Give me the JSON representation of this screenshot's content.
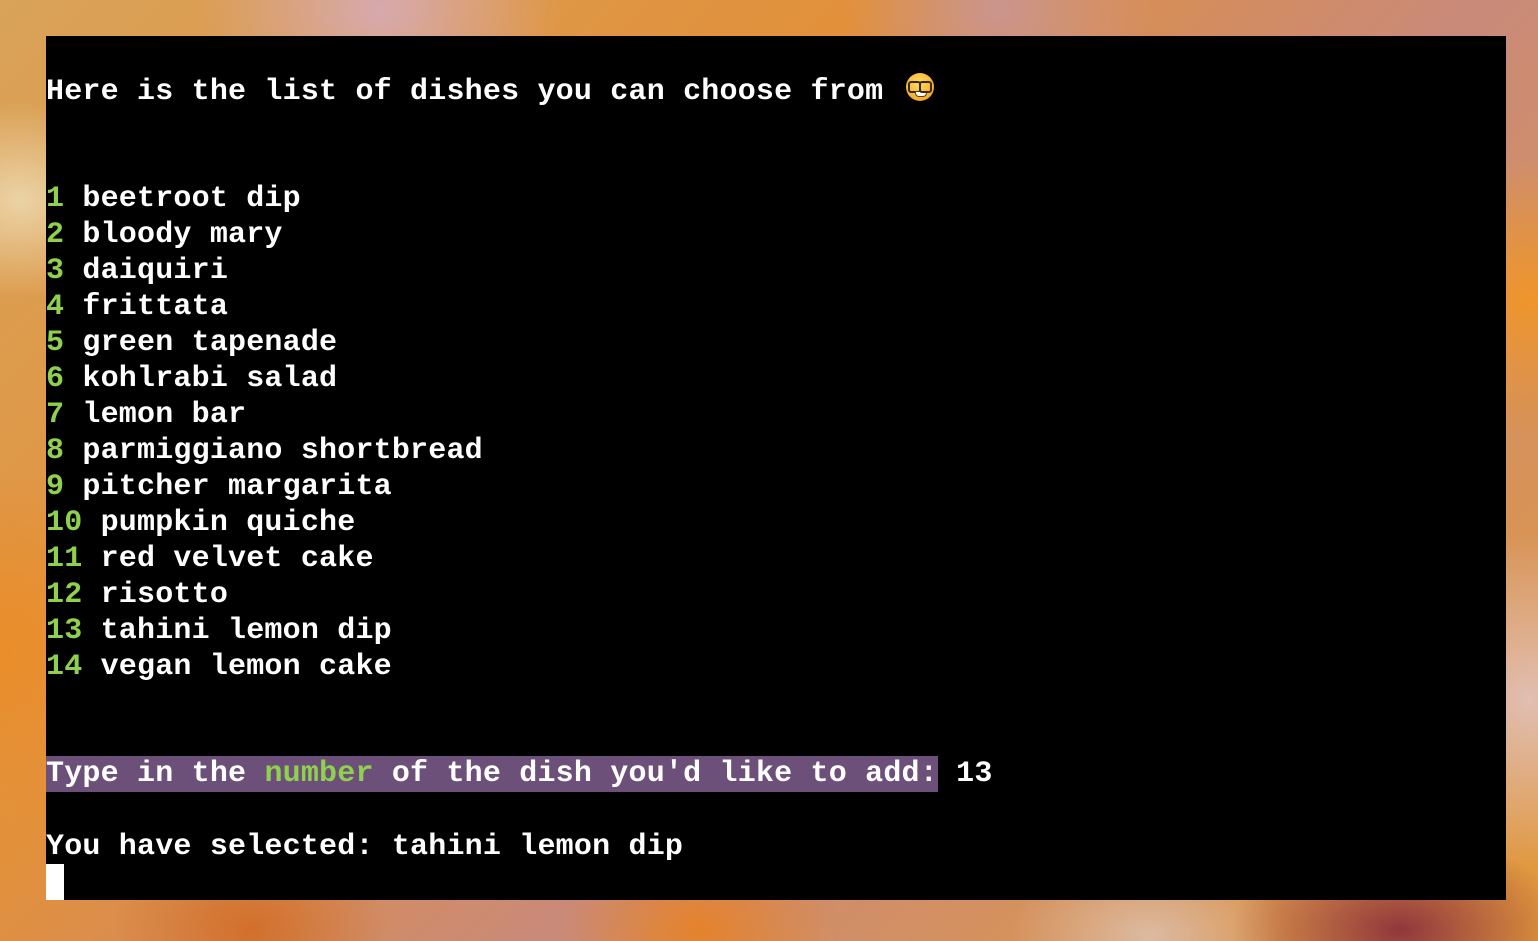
{
  "terminal": {
    "heading": "Here is the list of dishes you can choose from",
    "heading_emoji": "nerd-face-emoji",
    "dishes": [
      {
        "number": "1",
        "name": "beetroot dip"
      },
      {
        "number": "2",
        "name": "bloody mary"
      },
      {
        "number": "3",
        "name": "daiquiri"
      },
      {
        "number": "4",
        "name": "frittata"
      },
      {
        "number": "5",
        "name": "green tapenade"
      },
      {
        "number": "6",
        "name": "kohlrabi salad"
      },
      {
        "number": "7",
        "name": "lemon bar"
      },
      {
        "number": "8",
        "name": "parmiggiano shortbread"
      },
      {
        "number": "9",
        "name": "pitcher margarita"
      },
      {
        "number": "10",
        "name": "pumpkin quiche"
      },
      {
        "number": "11",
        "name": "red velvet cake"
      },
      {
        "number": "12",
        "name": "risotto"
      },
      {
        "number": "13",
        "name": "tahini lemon dip"
      },
      {
        "number": "14",
        "name": "vegan lemon cake"
      }
    ],
    "prompt": {
      "before": "Type in the ",
      "highlight": "number",
      "after": " of the dish you'd like to add:",
      "input_value": "13"
    },
    "selected": {
      "label": "You have selected: ",
      "value": "tahini lemon dip"
    }
  },
  "colors": {
    "accent_green": "#8fd14f",
    "prompt_background": "#6d5079",
    "terminal_background": "#000000",
    "text": "#ffffff"
  }
}
